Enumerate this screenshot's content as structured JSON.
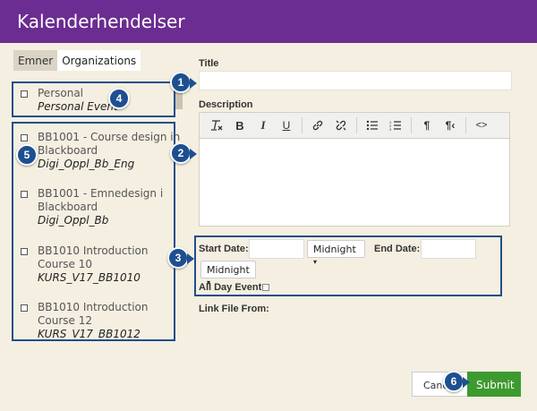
{
  "header": {
    "title": "Kalenderhendelser"
  },
  "tabs": [
    {
      "label": "Emner"
    },
    {
      "label": "Organizations"
    }
  ],
  "courses": [
    {
      "name": "Personal",
      "code": "Personal Event"
    },
    {
      "name": "BB1001 - Course design in Blackboard",
      "code": "Digi_Oppl_Bb_Eng"
    },
    {
      "name": "BB1001 - Emnedesign i Blackboard",
      "code": "Digi_Oppl_Bb"
    },
    {
      "name": "BB1010 Introduction Course 10",
      "code": "KURS_V17_BB1010"
    },
    {
      "name": "BB1010 Introduction Course 12",
      "code": "KURS_V17_BB1012"
    }
  ],
  "form": {
    "title_label": "Title",
    "title_value": "",
    "description_label": "Description",
    "start_date_label": "Start Date:",
    "start_time": "Midnight",
    "end_date_label": "End Date:",
    "end_time": "Midnight",
    "all_day_label": "All Day Event",
    "link_file_label": "Link File From:"
  },
  "toolbar_icons": [
    "clear-format-icon",
    "bold-icon",
    "italic-icon",
    "underline-icon",
    "link-icon",
    "unlink-icon",
    "bullet-list-icon",
    "numbered-list-icon",
    "ltr-icon",
    "rtl-icon",
    "source-code-icon"
  ],
  "buttons": {
    "cancel": "Cancel",
    "submit": "Submit"
  },
  "badges": [
    "1",
    "2",
    "3",
    "4",
    "5",
    "6"
  ],
  "colors": {
    "header": "#6b2d91",
    "submit": "#3d9a2f",
    "callout": "#1d4f91",
    "background": "#f4efe1"
  }
}
